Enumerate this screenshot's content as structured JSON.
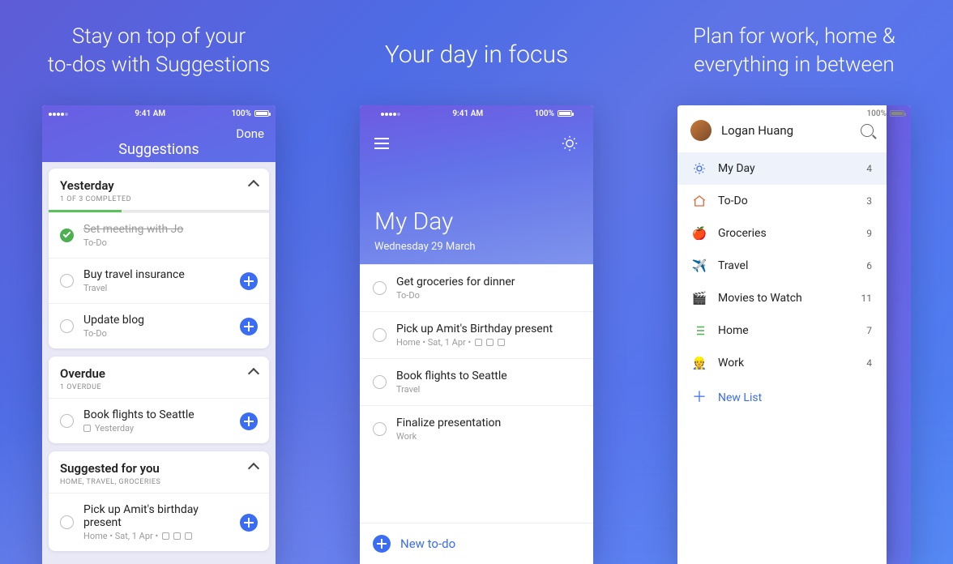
{
  "headings": {
    "h1_line1": "Stay on top of your",
    "h1_line2": "to-dos with Suggestions",
    "h2": "Your day in focus",
    "h3_line1": "Plan for work, home &",
    "h3_line2": "everything in between"
  },
  "status": {
    "time": "9:41 AM",
    "battery": "100%"
  },
  "phone1": {
    "title": "Suggestions",
    "done": "Done",
    "sections": {
      "yesterday": {
        "title": "Yesterday",
        "subtitle": "1 OF 3 COMPLETED",
        "items": [
          {
            "title": "Set meeting with Jo",
            "sub": "To-Do",
            "completed": true
          },
          {
            "title": "Buy travel insurance",
            "sub": "Travel"
          },
          {
            "title": "Update blog",
            "sub": "To-Do"
          }
        ]
      },
      "overdue": {
        "title": "Overdue",
        "subtitle": "1 OVERDUE",
        "items": [
          {
            "title": "Book flights to Seattle",
            "sub": "Yesterday"
          }
        ]
      },
      "suggested": {
        "title": "Suggested for you",
        "subtitle": "HOME, TRAVEL, GROCERIES",
        "items": [
          {
            "title": "Pick up Amit's birthday present",
            "sub": "Home  •  Sat, 1 Apr  •"
          }
        ]
      }
    }
  },
  "phone2": {
    "title": "My Day",
    "date": "Wednesday 29 March",
    "items": [
      {
        "title": "Get groceries for dinner",
        "sub": "To-Do"
      },
      {
        "title": "Pick up Amit's Birthday present",
        "sub": "Home  •  Sat, 1 Apr  •"
      },
      {
        "title": "Book flights to Seattle",
        "sub": "Travel"
      },
      {
        "title": "Finalize presentation",
        "sub": "Work"
      }
    ],
    "new_todo": "New to-do"
  },
  "phone3": {
    "profile_name": "Logan Huang",
    "items": [
      {
        "icon": "sun",
        "label": "My Day",
        "count": "4",
        "active": true
      },
      {
        "icon": "home",
        "label": "To-Do",
        "count": "3"
      },
      {
        "icon": "apple",
        "label": "Groceries",
        "count": "9"
      },
      {
        "icon": "plane",
        "label": "Travel",
        "count": "6"
      },
      {
        "icon": "clapper",
        "label": "Movies to Watch",
        "count": "11"
      },
      {
        "icon": "list",
        "label": "Home",
        "count": "7"
      },
      {
        "icon": "worker",
        "label": "Work",
        "count": "4"
      }
    ],
    "new_list": "New List"
  }
}
